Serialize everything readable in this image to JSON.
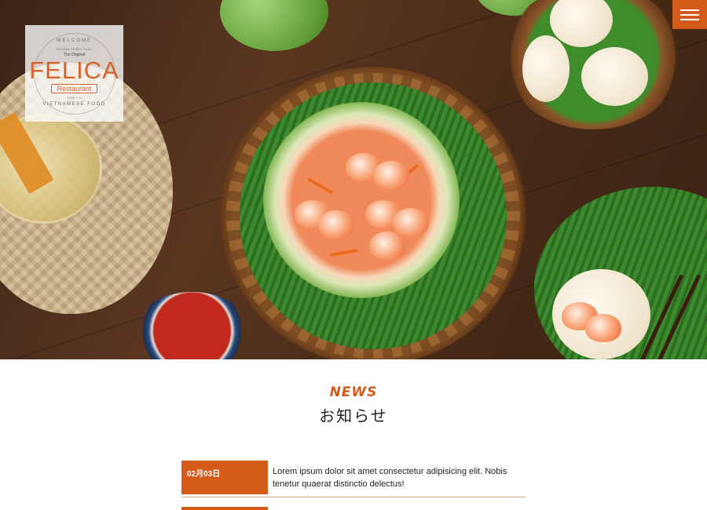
{
  "logo": {
    "welcome": "WELCOME",
    "established": "ESTABLISHED 2020",
    "original": "The Original",
    "name": "FELICA",
    "sub": "Restaurant",
    "city": "TOKYO",
    "tagline": "VIETNAMESE FOOD"
  },
  "menu": {
    "icon": "hamburger-icon"
  },
  "news": {
    "heading_en": "NEWS",
    "heading_ja": "お知らせ",
    "items": [
      {
        "date": "02月03日",
        "text": "Lorem ipsum dolor sit amet consectetur adipisicing elit. Nobis tenetur quaerat distinctio delectus!"
      },
      {
        "date": "",
        "text": ""
      }
    ]
  },
  "colors": {
    "accent": "#d35a18",
    "logo_orange": "#d5632c"
  }
}
